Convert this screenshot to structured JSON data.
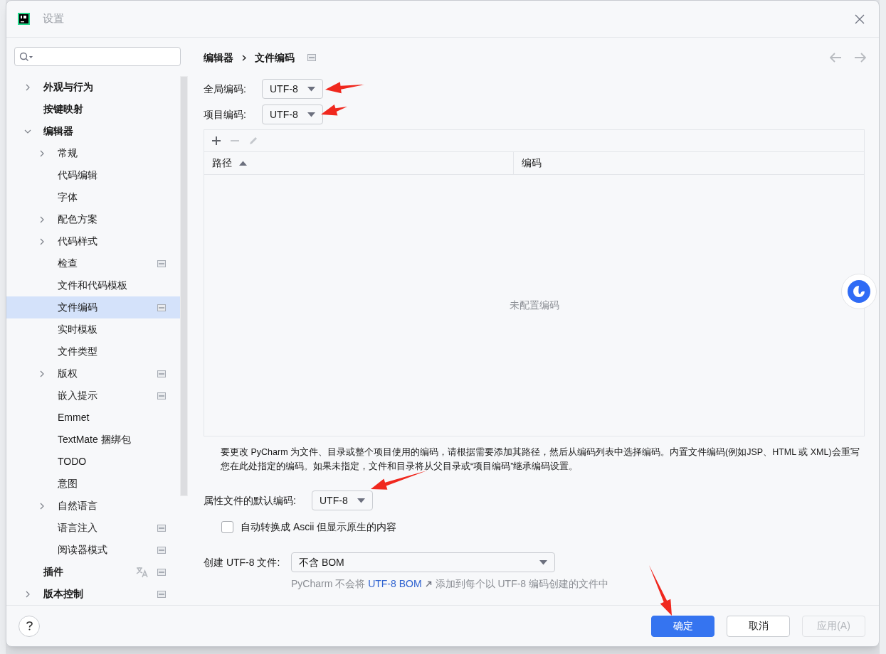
{
  "window": {
    "title": "设置"
  },
  "tree": [
    {
      "label": "外观与行为",
      "bold": true,
      "expanded": false,
      "selected": false
    },
    {
      "label": "按键映射",
      "bold": true,
      "selected": false
    },
    {
      "label": "编辑器",
      "bold": true,
      "expanded": true,
      "selected": false,
      "children": [
        {
          "label": "常规",
          "expanded": false,
          "selected": false
        },
        {
          "label": "代码编辑",
          "selected": false
        },
        {
          "label": "字体",
          "selected": false
        },
        {
          "label": "配色方案",
          "expanded": false,
          "selected": false
        },
        {
          "label": "代码样式",
          "expanded": false,
          "selected": false
        },
        {
          "label": "检查",
          "badge": true,
          "selected": false
        },
        {
          "label": "文件和代码模板",
          "selected": false
        },
        {
          "label": "文件编码",
          "badge": true,
          "selected": true
        },
        {
          "label": "实时模板",
          "selected": false
        },
        {
          "label": "文件类型",
          "selected": false
        },
        {
          "label": "版权",
          "expanded": false,
          "badge": true,
          "selected": false
        },
        {
          "label": "嵌入提示",
          "badge": true,
          "selected": false
        },
        {
          "label": "Emmet",
          "selected": false
        },
        {
          "label": "TextMate 捆绑包",
          "selected": false
        },
        {
          "label": "TODO",
          "selected": false
        },
        {
          "label": "意图",
          "selected": false
        },
        {
          "label": "自然语言",
          "expanded": false,
          "selected": false
        },
        {
          "label": "语言注入",
          "badge": true,
          "selected": false
        },
        {
          "label": "阅读器模式",
          "badge": true,
          "selected": false
        }
      ]
    },
    {
      "label": "插件",
      "bold": true,
      "translated": true,
      "badge": true,
      "selected": false
    },
    {
      "label": "版本控制",
      "bold": true,
      "expanded": false,
      "badge": true,
      "selected": false
    }
  ],
  "breadcrumb": {
    "items": [
      "编辑器",
      "文件编码"
    ],
    "badge": true
  },
  "nav": {
    "back_disabled": true,
    "forward_disabled": true
  },
  "global_encoding": {
    "label": "全局编码:",
    "value": "UTF-8"
  },
  "project_encoding": {
    "label": "项目编码:",
    "value": "UTF-8"
  },
  "table": {
    "toolbar": [
      {
        "kind": "add",
        "disabled": false
      },
      {
        "kind": "remove",
        "disabled": true
      },
      {
        "kind": "edit",
        "disabled": true
      }
    ],
    "columns": [
      {
        "label": "路径",
        "sort_ascending": true
      },
      {
        "label": "编码"
      }
    ],
    "empty_text": "未配置编码"
  },
  "description": "要更改 PyCharm 为文件、目录或整个项目使用的编码，请根据需要添加其路径，然后从编码列表中选择编码。内置文件编码(例如JSP、HTML 或 XML)会重写您在此处指定的编码。如果未指定，文件和目录将从父目录或“项目编码”继承编码设置。",
  "properties_encoding": {
    "label": "属性文件的默认编码:",
    "value": "UTF-8"
  },
  "ascii_checkbox": {
    "label": "自动转换成 Ascii 但显示原生的内容",
    "checked": false
  },
  "create_utf8": {
    "label": "创建 UTF-8 文件:",
    "value": "不含 BOM",
    "hint": {
      "before": "PyCharm 不会将",
      "link": "UTF-8 BOM",
      "after": "添加到每个以 UTF-8 编码创建的文件中"
    }
  },
  "buttons": [
    {
      "label": "确定",
      "kind": "primary",
      "disabled": false
    },
    {
      "label": "取消",
      "kind": "default",
      "disabled": false
    },
    {
      "label": "应用(A)",
      "kind": "default",
      "disabled": true
    }
  ]
}
